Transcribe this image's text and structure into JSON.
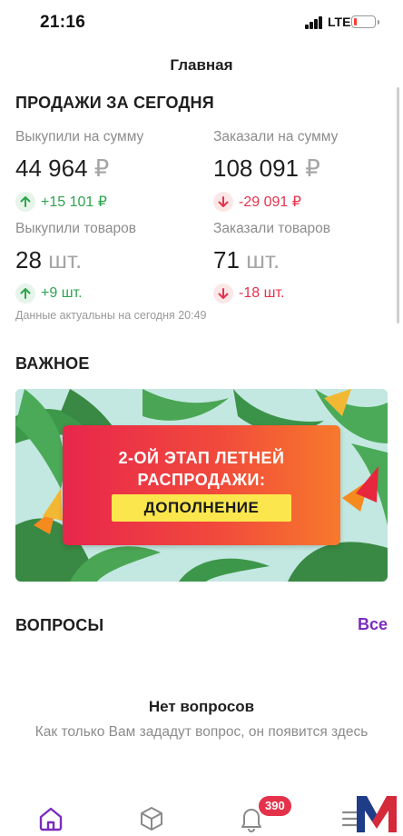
{
  "status_bar": {
    "time": "21:16",
    "network": "LTE"
  },
  "header": {
    "title": "Главная"
  },
  "sales": {
    "section_title": "ПРОДАЖИ ЗА СЕГОДНЯ",
    "bought_sum": {
      "label": "Выкупили на сумму",
      "value": "44 964",
      "unit": "₽",
      "delta": "+15 101 ₽",
      "trend": "up"
    },
    "ordered_sum": {
      "label": "Заказали на сумму",
      "value": "108 091",
      "unit": "₽",
      "delta": "-29 091 ₽",
      "trend": "down"
    },
    "bought_items": {
      "label": "Выкупили товаров",
      "value": "28",
      "unit": "шт.",
      "delta": "+9 шт.",
      "trend": "up"
    },
    "ordered_items": {
      "label": "Заказали товаров",
      "value": "71",
      "unit": "шт.",
      "delta": "-18 шт.",
      "trend": "down"
    },
    "updated_note": "Данные актуальны на сегодня 20:49"
  },
  "important": {
    "section_title": "ВАЖНОЕ",
    "banner": {
      "line1": "2-ОЙ ЭТАП ЛЕТНЕЙ",
      "line2": "РАСПРОДАЖИ:",
      "pill": "ДОПОЛНЕНИЕ"
    }
  },
  "questions": {
    "section_title": "ВОПРОСЫ",
    "see_all": "Все",
    "empty_title": "Нет вопросов",
    "empty_text": "Как только Вам зададут вопрос, он появится здесь"
  },
  "bottom_nav": {
    "items": [
      {
        "name": "home",
        "icon": "home-icon",
        "active": true
      },
      {
        "name": "products",
        "icon": "box-icon",
        "active": false
      },
      {
        "name": "notifications",
        "icon": "bell-icon",
        "active": false
      },
      {
        "name": "menu",
        "icon": "menu-icon",
        "active": false
      }
    ],
    "notifications_badge": "390"
  },
  "colors": {
    "accent": "#7b2bbd",
    "positive": "#2ea44f",
    "negative": "#e5324b",
    "badge": "#e5324b"
  }
}
